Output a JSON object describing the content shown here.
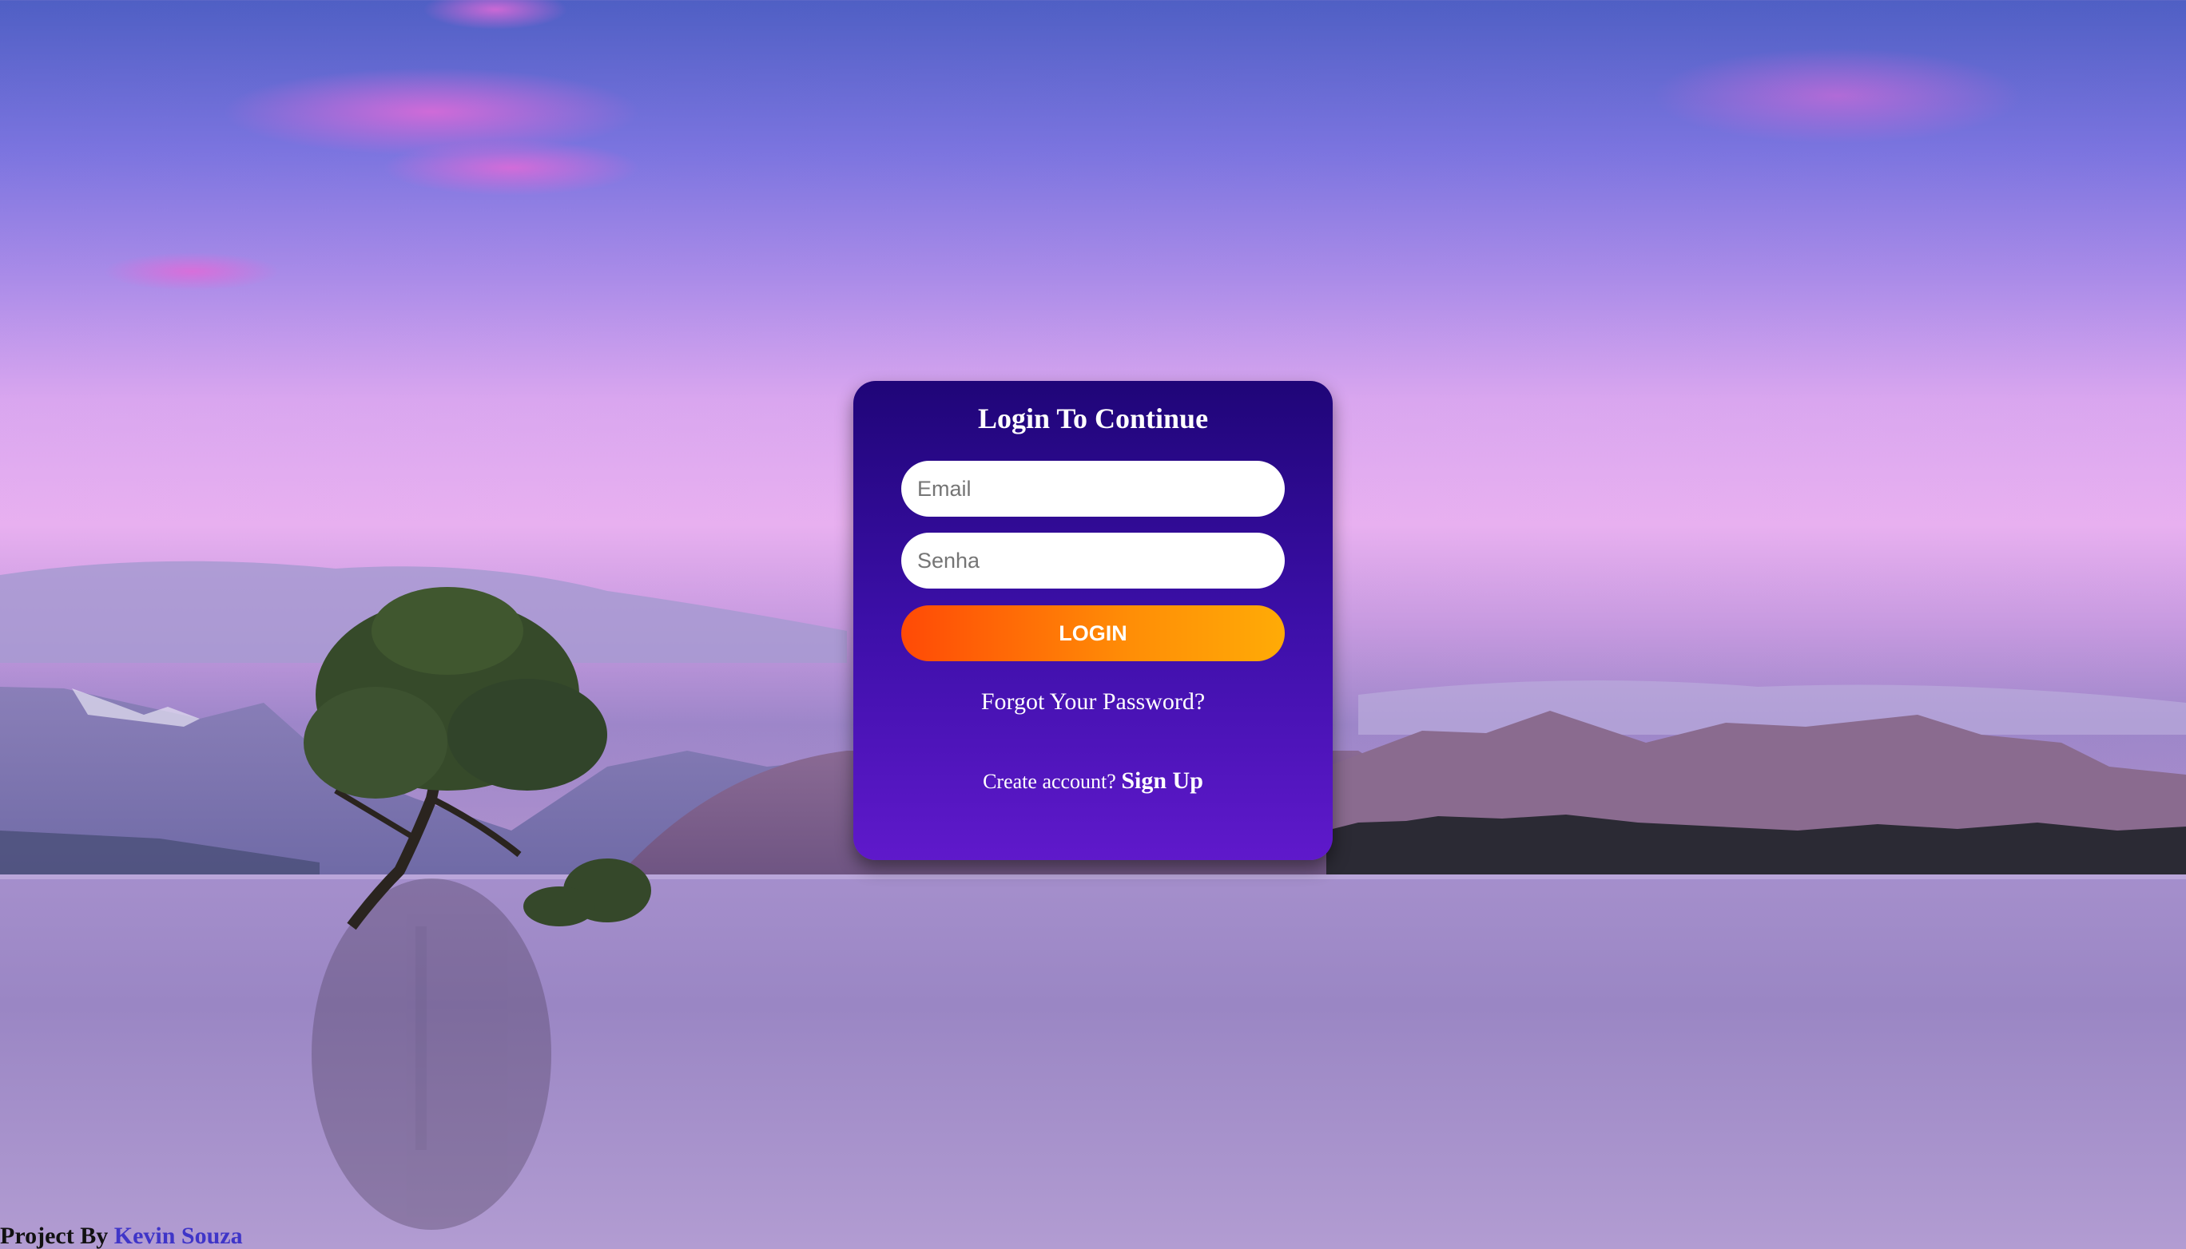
{
  "login": {
    "title": "Login To Continue",
    "email_placeholder": "Email",
    "password_placeholder": "Senha",
    "login_label": "LOGIN",
    "forgot_label": "Forgot Your Password?",
    "signup_prompt": "Create account?",
    "signup_label": "Sign Up"
  },
  "footer": {
    "prefix": "Project By",
    "author": "Kevin Souza"
  },
  "colors": {
    "card_top": "#1f0578",
    "card_bottom": "#5f19cb",
    "button_left": "#ff4a06",
    "button_right": "#ffab06",
    "author_link": "#3f35c8"
  }
}
